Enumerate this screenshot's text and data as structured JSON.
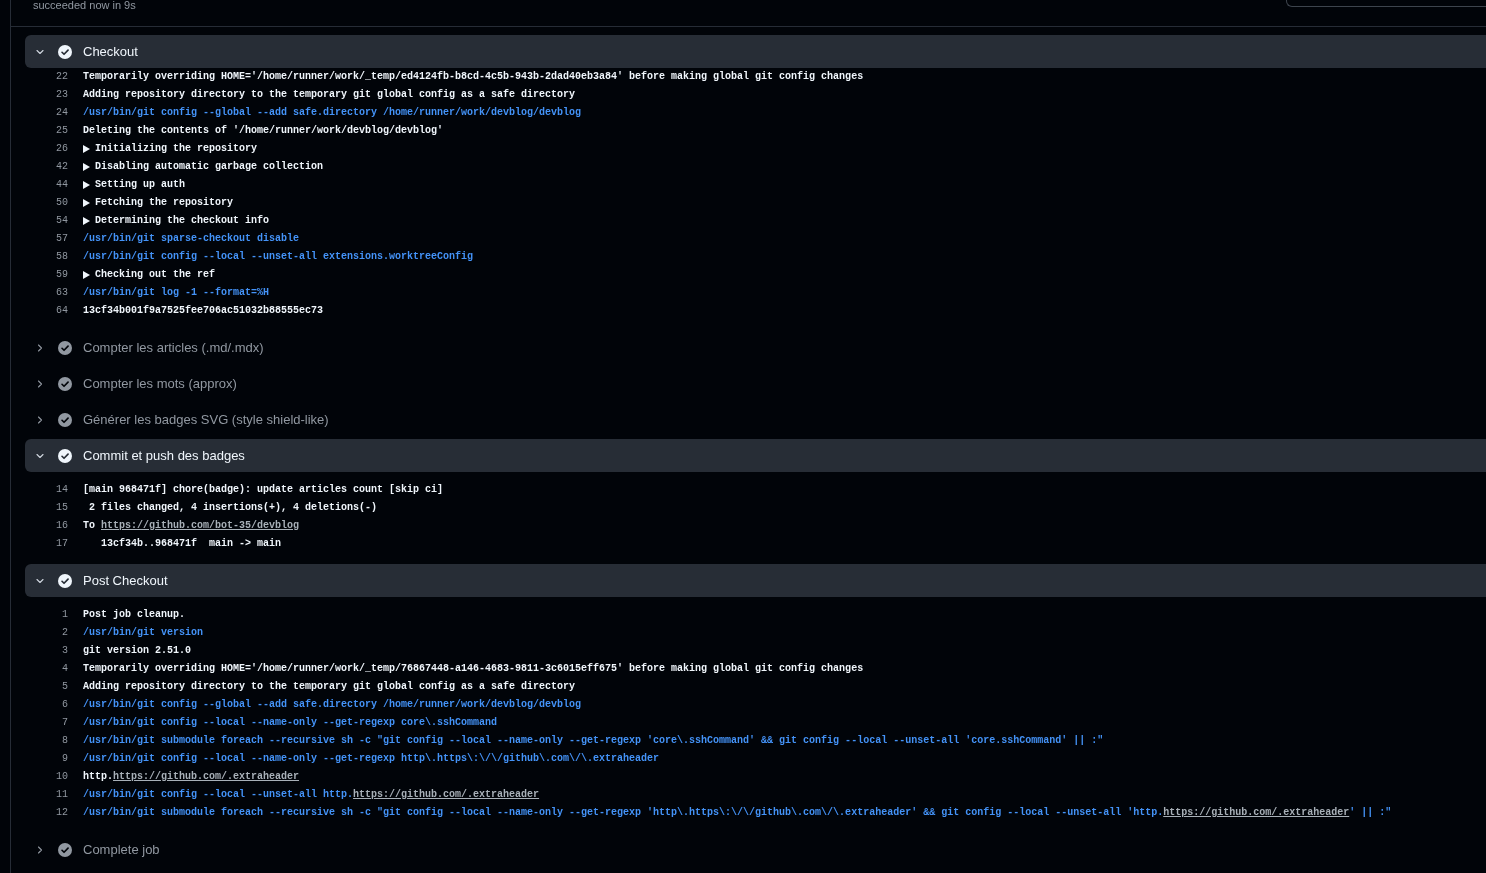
{
  "top_bar": {
    "status": "succeeded now in 9s"
  },
  "steps": [
    {
      "title": "Checkout",
      "expanded": true,
      "lines": [
        {
          "number": "22",
          "kind": "output",
          "text": "Temporarily overriding HOME='/home/runner/work/_temp/ed4124fb-b8cd-4c5b-943b-2dad40eb3a84' before making global git config changes"
        },
        {
          "number": "23",
          "kind": "output",
          "text": "Adding repository directory to the temporary git global config as a safe directory"
        },
        {
          "number": "24",
          "kind": "command",
          "text": "/usr/bin/git config --global --add safe.directory /home/runner/work/devblog/devblog"
        },
        {
          "number": "25",
          "kind": "output",
          "text": "Deleting the contents of '/home/runner/work/devblog/devblog'"
        },
        {
          "number": "26",
          "kind": "group",
          "text": "Initializing the repository"
        },
        {
          "number": "42",
          "kind": "group",
          "text": "Disabling automatic garbage collection"
        },
        {
          "number": "44",
          "kind": "group",
          "text": "Setting up auth"
        },
        {
          "number": "50",
          "kind": "group",
          "text": "Fetching the repository"
        },
        {
          "number": "54",
          "kind": "group",
          "text": "Determining the checkout info"
        },
        {
          "number": "57",
          "kind": "command",
          "text": "/usr/bin/git sparse-checkout disable"
        },
        {
          "number": "58",
          "kind": "command",
          "text": "/usr/bin/git config --local --unset-all extensions.worktreeConfig"
        },
        {
          "number": "59",
          "kind": "group",
          "text": "Checking out the ref"
        },
        {
          "number": "63",
          "kind": "command",
          "text": "/usr/bin/git log -1 --format=%H"
        },
        {
          "number": "64",
          "kind": "output",
          "text": "13cf34b001f9a7525fee706ac51032b88555ec73"
        }
      ]
    },
    {
      "title": "Compter les articles (.md/.mdx)",
      "expanded": false
    },
    {
      "title": "Compter les mots (approx)",
      "expanded": false
    },
    {
      "title": "Générer les badges SVG (style shield-like)",
      "expanded": false
    },
    {
      "title": "Commit et push des badges",
      "expanded": true,
      "lines": [
        {
          "number": "14",
          "kind": "output",
          "text": "[main 968471f] chore(badge): update articles count [skip ci]"
        },
        {
          "number": "15",
          "kind": "output",
          "text": " 2 files changed, 4 insertions(+), 4 deletions(-)"
        },
        {
          "number": "16",
          "kind": "output",
          "parts": [
            {
              "kind": "text",
              "text": "To "
            },
            {
              "kind": "link",
              "text": "https://github.com/bot-35/devblog"
            }
          ]
        },
        {
          "number": "17",
          "kind": "output",
          "text": "   13cf34b..968471f  main -> main"
        }
      ]
    },
    {
      "title": "Post Checkout",
      "expanded": true,
      "lines": [
        {
          "number": "1",
          "kind": "output",
          "text": "Post job cleanup."
        },
        {
          "number": "2",
          "kind": "command",
          "text": "/usr/bin/git version"
        },
        {
          "number": "3",
          "kind": "output",
          "text": "git version 2.51.0"
        },
        {
          "number": "4",
          "kind": "output",
          "text": "Temporarily overriding HOME='/home/runner/work/_temp/76867448-a146-4683-9811-3c6015eff675' before making global git config changes"
        },
        {
          "number": "5",
          "kind": "output",
          "text": "Adding repository directory to the temporary git global config as a safe directory"
        },
        {
          "number": "6",
          "kind": "command",
          "text": "/usr/bin/git config --global --add safe.directory /home/runner/work/devblog/devblog"
        },
        {
          "number": "7",
          "kind": "command",
          "text": "/usr/bin/git config --local --name-only --get-regexp core\\.sshCommand"
        },
        {
          "number": "8",
          "kind": "command",
          "text": "/usr/bin/git submodule foreach --recursive sh -c \"git config --local --name-only --get-regexp 'core\\.sshCommand' && git config --local --unset-all 'core.sshCommand' || :\""
        },
        {
          "number": "9",
          "kind": "command",
          "text": "/usr/bin/git config --local --name-only --get-regexp http\\.https\\:\\/\\/github\\.com\\/\\.extraheader"
        },
        {
          "number": "10",
          "kind": "output",
          "parts": [
            {
              "kind": "text",
              "text": "http."
            },
            {
              "kind": "link",
              "text": "https://github.com/.extraheader"
            }
          ]
        },
        {
          "number": "11",
          "kind": "command",
          "parts": [
            {
              "kind": "text",
              "text": "/usr/bin/git config --local --unset-all http."
            },
            {
              "kind": "link",
              "text": "https://github.com/.extraheader"
            }
          ]
        },
        {
          "number": "12",
          "kind": "command",
          "parts": [
            {
              "kind": "text",
              "text": "/usr/bin/git submodule foreach --recursive sh -c \"git config --local --name-only --get-regexp 'http\\.https\\:\\/\\/github\\.com\\/\\.extraheader' && git config --local --unset-all 'http."
            },
            {
              "kind": "link",
              "text": "https://github.com/.extraheader"
            },
            {
              "kind": "text",
              "text": "' || :\""
            }
          ]
        }
      ]
    },
    {
      "title": "Complete job",
      "expanded": false
    }
  ]
}
